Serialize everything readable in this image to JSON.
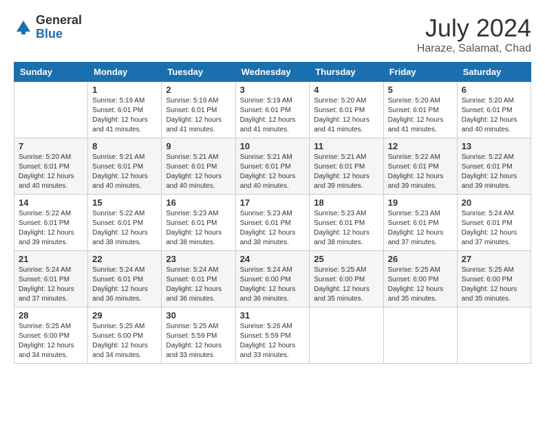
{
  "header": {
    "logo_general": "General",
    "logo_blue": "Blue",
    "month_title": "July 2024",
    "location": "Haraze, Salamat, Chad"
  },
  "weekdays": [
    "Sunday",
    "Monday",
    "Tuesday",
    "Wednesday",
    "Thursday",
    "Friday",
    "Saturday"
  ],
  "weeks": [
    [
      {
        "day": "",
        "sunrise": "",
        "sunset": "",
        "daylight": ""
      },
      {
        "day": "1",
        "sunrise": "Sunrise: 5:19 AM",
        "sunset": "Sunset: 6:01 PM",
        "daylight": "Daylight: 12 hours and 41 minutes."
      },
      {
        "day": "2",
        "sunrise": "Sunrise: 5:19 AM",
        "sunset": "Sunset: 6:01 PM",
        "daylight": "Daylight: 12 hours and 41 minutes."
      },
      {
        "day": "3",
        "sunrise": "Sunrise: 5:19 AM",
        "sunset": "Sunset: 6:01 PM",
        "daylight": "Daylight: 12 hours and 41 minutes."
      },
      {
        "day": "4",
        "sunrise": "Sunrise: 5:20 AM",
        "sunset": "Sunset: 6:01 PM",
        "daylight": "Daylight: 12 hours and 41 minutes."
      },
      {
        "day": "5",
        "sunrise": "Sunrise: 5:20 AM",
        "sunset": "Sunset: 6:01 PM",
        "daylight": "Daylight: 12 hours and 41 minutes."
      },
      {
        "day": "6",
        "sunrise": "Sunrise: 5:20 AM",
        "sunset": "Sunset: 6:01 PM",
        "daylight": "Daylight: 12 hours and 40 minutes."
      }
    ],
    [
      {
        "day": "7",
        "sunrise": "Sunrise: 5:20 AM",
        "sunset": "Sunset: 6:01 PM",
        "daylight": "Daylight: 12 hours and 40 minutes."
      },
      {
        "day": "8",
        "sunrise": "Sunrise: 5:21 AM",
        "sunset": "Sunset: 6:01 PM",
        "daylight": "Daylight: 12 hours and 40 minutes."
      },
      {
        "day": "9",
        "sunrise": "Sunrise: 5:21 AM",
        "sunset": "Sunset: 6:01 PM",
        "daylight": "Daylight: 12 hours and 40 minutes."
      },
      {
        "day": "10",
        "sunrise": "Sunrise: 5:21 AM",
        "sunset": "Sunset: 6:01 PM",
        "daylight": "Daylight: 12 hours and 40 minutes."
      },
      {
        "day": "11",
        "sunrise": "Sunrise: 5:21 AM",
        "sunset": "Sunset: 6:01 PM",
        "daylight": "Daylight: 12 hours and 39 minutes."
      },
      {
        "day": "12",
        "sunrise": "Sunrise: 5:22 AM",
        "sunset": "Sunset: 6:01 PM",
        "daylight": "Daylight: 12 hours and 39 minutes."
      },
      {
        "day": "13",
        "sunrise": "Sunrise: 5:22 AM",
        "sunset": "Sunset: 6:01 PM",
        "daylight": "Daylight: 12 hours and 39 minutes."
      }
    ],
    [
      {
        "day": "14",
        "sunrise": "Sunrise: 5:22 AM",
        "sunset": "Sunset: 6:01 PM",
        "daylight": "Daylight: 12 hours and 39 minutes."
      },
      {
        "day": "15",
        "sunrise": "Sunrise: 5:22 AM",
        "sunset": "Sunset: 6:01 PM",
        "daylight": "Daylight: 12 hours and 38 minutes."
      },
      {
        "day": "16",
        "sunrise": "Sunrise: 5:23 AM",
        "sunset": "Sunset: 6:01 PM",
        "daylight": "Daylight: 12 hours and 38 minutes."
      },
      {
        "day": "17",
        "sunrise": "Sunrise: 5:23 AM",
        "sunset": "Sunset: 6:01 PM",
        "daylight": "Daylight: 12 hours and 38 minutes."
      },
      {
        "day": "18",
        "sunrise": "Sunrise: 5:23 AM",
        "sunset": "Sunset: 6:01 PM",
        "daylight": "Daylight: 12 hours and 38 minutes."
      },
      {
        "day": "19",
        "sunrise": "Sunrise: 5:23 AM",
        "sunset": "Sunset: 6:01 PM",
        "daylight": "Daylight: 12 hours and 37 minutes."
      },
      {
        "day": "20",
        "sunrise": "Sunrise: 5:24 AM",
        "sunset": "Sunset: 6:01 PM",
        "daylight": "Daylight: 12 hours and 37 minutes."
      }
    ],
    [
      {
        "day": "21",
        "sunrise": "Sunrise: 5:24 AM",
        "sunset": "Sunset: 6:01 PM",
        "daylight": "Daylight: 12 hours and 37 minutes."
      },
      {
        "day": "22",
        "sunrise": "Sunrise: 5:24 AM",
        "sunset": "Sunset: 6:01 PM",
        "daylight": "Daylight: 12 hours and 36 minutes."
      },
      {
        "day": "23",
        "sunrise": "Sunrise: 5:24 AM",
        "sunset": "Sunset: 6:01 PM",
        "daylight": "Daylight: 12 hours and 36 minutes."
      },
      {
        "day": "24",
        "sunrise": "Sunrise: 5:24 AM",
        "sunset": "Sunset: 6:00 PM",
        "daylight": "Daylight: 12 hours and 36 minutes."
      },
      {
        "day": "25",
        "sunrise": "Sunrise: 5:25 AM",
        "sunset": "Sunset: 6:00 PM",
        "daylight": "Daylight: 12 hours and 35 minutes."
      },
      {
        "day": "26",
        "sunrise": "Sunrise: 5:25 AM",
        "sunset": "Sunset: 6:00 PM",
        "daylight": "Daylight: 12 hours and 35 minutes."
      },
      {
        "day": "27",
        "sunrise": "Sunrise: 5:25 AM",
        "sunset": "Sunset: 6:00 PM",
        "daylight": "Daylight: 12 hours and 35 minutes."
      }
    ],
    [
      {
        "day": "28",
        "sunrise": "Sunrise: 5:25 AM",
        "sunset": "Sunset: 6:00 PM",
        "daylight": "Daylight: 12 hours and 34 minutes."
      },
      {
        "day": "29",
        "sunrise": "Sunrise: 5:25 AM",
        "sunset": "Sunset: 6:00 PM",
        "daylight": "Daylight: 12 hours and 34 minutes."
      },
      {
        "day": "30",
        "sunrise": "Sunrise: 5:25 AM",
        "sunset": "Sunset: 5:59 PM",
        "daylight": "Daylight: 12 hours and 33 minutes."
      },
      {
        "day": "31",
        "sunrise": "Sunrise: 5:26 AM",
        "sunset": "Sunset: 5:59 PM",
        "daylight": "Daylight: 12 hours and 33 minutes."
      },
      {
        "day": "",
        "sunrise": "",
        "sunset": "",
        "daylight": ""
      },
      {
        "day": "",
        "sunrise": "",
        "sunset": "",
        "daylight": ""
      },
      {
        "day": "",
        "sunrise": "",
        "sunset": "",
        "daylight": ""
      }
    ]
  ]
}
